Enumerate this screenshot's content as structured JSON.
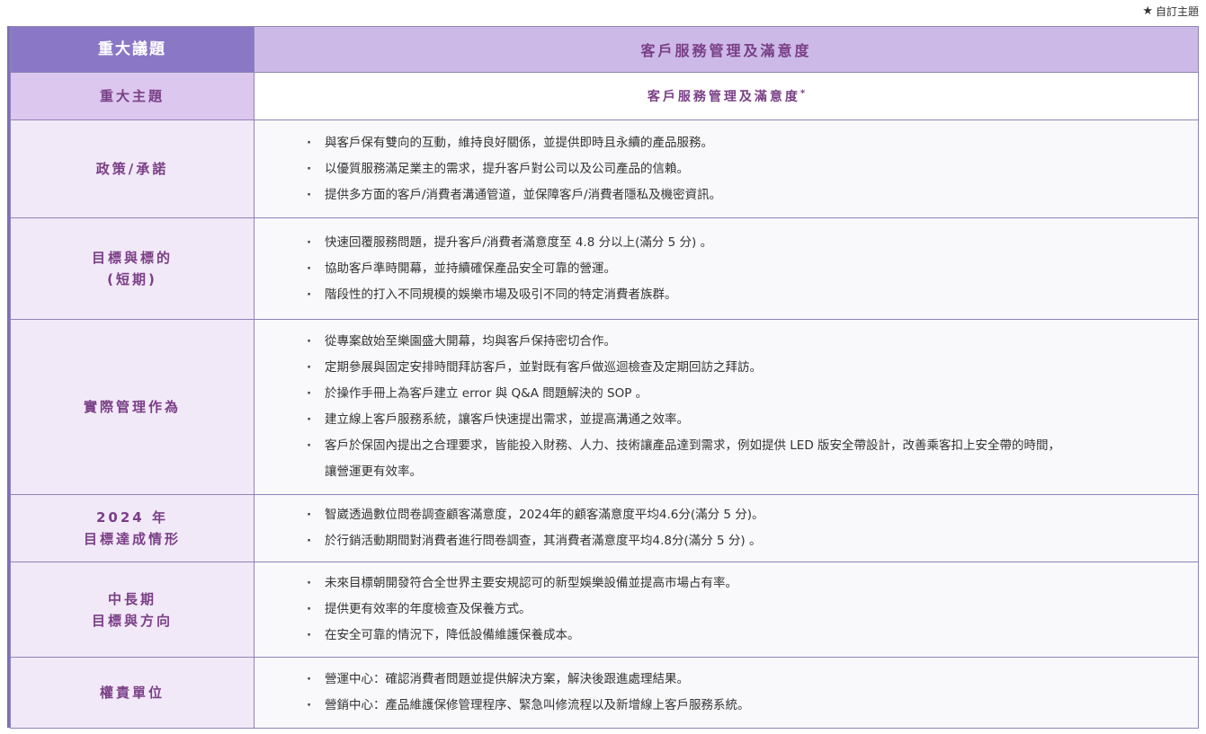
{
  "custom_topic_note": {
    "icon": "star-icon",
    "label": "自訂主題"
  },
  "table": {
    "header": {
      "label": "重大議題",
      "value": "客戶服務管理及滿意度"
    },
    "subheader": {
      "label": "重大主題",
      "value": "客戶服務管理及滿意度",
      "mark": "*"
    },
    "rows": [
      {
        "label_lines": [
          "政策/承諾"
        ],
        "items": [
          "與客戶保有雙向的互動，維持良好關係，並提供即時且永續的產品服務。",
          "以優質服務滿足業主的需求，提升客戶對公司以及公司產品的信賴。",
          "提供多方面的客戶/消費者溝通管道，並保障客戶/消費者隱私及機密資訊。"
        ]
      },
      {
        "label_lines": [
          "目標與標的",
          "(短期)"
        ],
        "items": [
          "快速回覆服務問題，提升客戶/消費者滿意度至 4.8 分以上(滿分 5 分) 。",
          "協助客戶準時開幕，並持續確保產品安全可靠的營運。",
          "階段性的打入不同規模的娛樂市場及吸引不同的特定消費者族群。"
        ]
      },
      {
        "label_lines": [
          "實際管理作為"
        ],
        "items": [
          "從專案啟始至樂園盛大開幕，均與客戶保持密切合作。",
          "定期參展與固定安排時間拜訪客戶，並對既有客戶做巡迴檢查及定期回訪之拜訪。",
          "於操作手冊上為客戶建立 error 與 Q&A 問題解決的 SOP 。",
          "建立線上客戶服務系統，讓客戶快速提出需求，並提高溝通之效率。",
          "客戶於保固內提出之合理要求，皆能投入財務、人力、技術讓產品達到需求，例如提供 LED 版安全帶設計，改善乘客扣上安全帶的時間，讓營運更有效率。"
        ]
      },
      {
        "label_lines": [
          "2024 年",
          "目標達成情形"
        ],
        "items": [
          "智崴透過數位問卷調查顧客滿意度，2024年的顧客滿意度平均4.6分(滿分 5 分)。",
          "於行銷活動期間對消費者進行問卷調查，其消費者滿意度平均4.8分(滿分 5 分) 。"
        ]
      },
      {
        "label_lines": [
          "中長期",
          "目標與方向"
        ],
        "items": [
          "未來目標朝開發符合全世界主要安規認可的新型娛樂設備並提高市場占有率。",
          "提供更有效率的年度檢查及保養方式。",
          "在安全可靠的情況下，降低設備維護保養成本。"
        ]
      },
      {
        "label_lines": [
          "權責單位"
        ],
        "items": [
          "營運中心：確認消費者問題並提供解決方案，解決後跟進處理結果。",
          "營銷中心：產品維護保修管理程序、緊急叫修流程以及新增線上客戶服務系統。"
        ]
      }
    ]
  }
}
